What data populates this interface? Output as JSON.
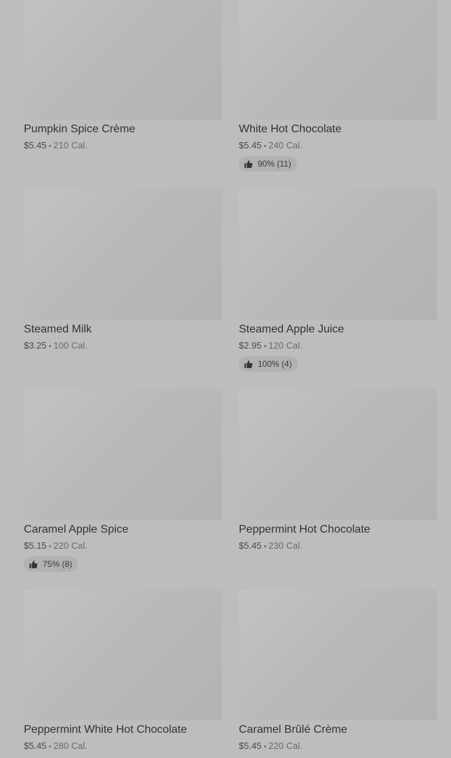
{
  "menu": {
    "items": [
      {
        "name": "Pumpkin Spice Crème",
        "price": "$5.45",
        "separator": "•",
        "calories": "210 Cal.",
        "rating": null
      },
      {
        "name": "White Hot Chocolate",
        "price": "$5.45",
        "separator": "•",
        "calories": "240 Cal.",
        "rating": "90% (11)"
      },
      {
        "name": "Steamed Milk",
        "price": "$3.25",
        "separator": "•",
        "calories": "100 Cal.",
        "rating": null
      },
      {
        "name": "Steamed Apple Juice",
        "price": "$2.95",
        "separator": "•",
        "calories": "120 Cal.",
        "rating": "100% (4)"
      },
      {
        "name": "Caramel Apple Spice",
        "price": "$5.15",
        "separator": "•",
        "calories": "220 Cal.",
        "rating": "75% (8)"
      },
      {
        "name": "Peppermint Hot Chocolate",
        "price": "$5.45",
        "separator": "•",
        "calories": "230 Cal.",
        "rating": null
      },
      {
        "name": "Peppermint White Hot Chocolate",
        "price": "$5.45",
        "separator": "•",
        "calories": "280 Cal.",
        "rating": null
      },
      {
        "name": "Caramel Brûlé Crème",
        "price": "$5.45",
        "separator": "•",
        "calories": "220 Cal.",
        "rating": null
      }
    ]
  },
  "icons": {
    "rating": "thumbs-up-icon"
  },
  "colors": {
    "overlay_background": "#bdbdbd",
    "image_placeholder": "#b9b9b9",
    "rating_pill": "#b1b1b1"
  }
}
